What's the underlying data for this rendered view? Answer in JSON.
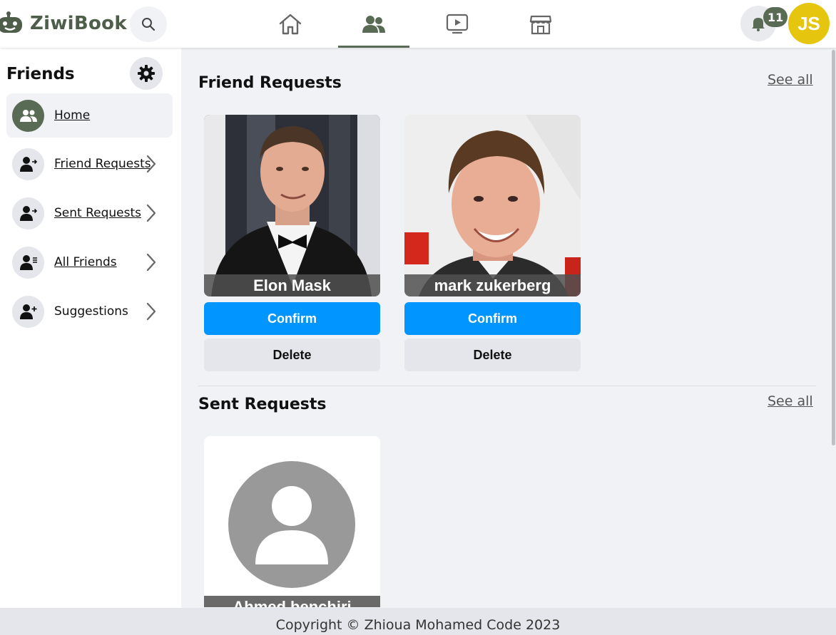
{
  "app": {
    "name": "ZiwiBook"
  },
  "topbar": {
    "nav": [
      {
        "name": "home",
        "icon": "home-icon"
      },
      {
        "name": "friends",
        "icon": "friends-icon",
        "active": true
      },
      {
        "name": "watch",
        "icon": "video-icon"
      },
      {
        "name": "marketplace",
        "icon": "store-icon"
      }
    ],
    "notifications_count": "11",
    "user_initials": "JS",
    "accent": "#5a6b55",
    "avatar_color": "#e6c50e"
  },
  "sidebar": {
    "title": "Friends",
    "items": [
      {
        "label": "Home",
        "icon": "friends-icon",
        "active": true
      },
      {
        "label": "Friend Requests",
        "icon": "friend-request-icon"
      },
      {
        "label": "Sent Requests",
        "icon": "sent-request-icon"
      },
      {
        "label": "All Friends",
        "icon": "friend-list-icon"
      },
      {
        "label": "Suggestions",
        "icon": "add-friend-icon"
      }
    ]
  },
  "main": {
    "friend_requests": {
      "title": "Friend Requests",
      "see_all": "See all",
      "cards": [
        {
          "name": "Elon Mask",
          "confirm": "Confirm",
          "delete": "Delete"
        },
        {
          "name": "mark zukerberg",
          "confirm": "Confirm",
          "delete": "Delete"
        }
      ]
    },
    "sent_requests": {
      "title": "Sent Requests",
      "see_all": "See all",
      "cards": [
        {
          "name": "Ahmed benchiri"
        }
      ]
    }
  },
  "footer": {
    "text": "Copyright © Zhioua Mohamed Code 2023"
  },
  "colors": {
    "confirm": "#0095ff",
    "delete": "#e4e6eb"
  }
}
